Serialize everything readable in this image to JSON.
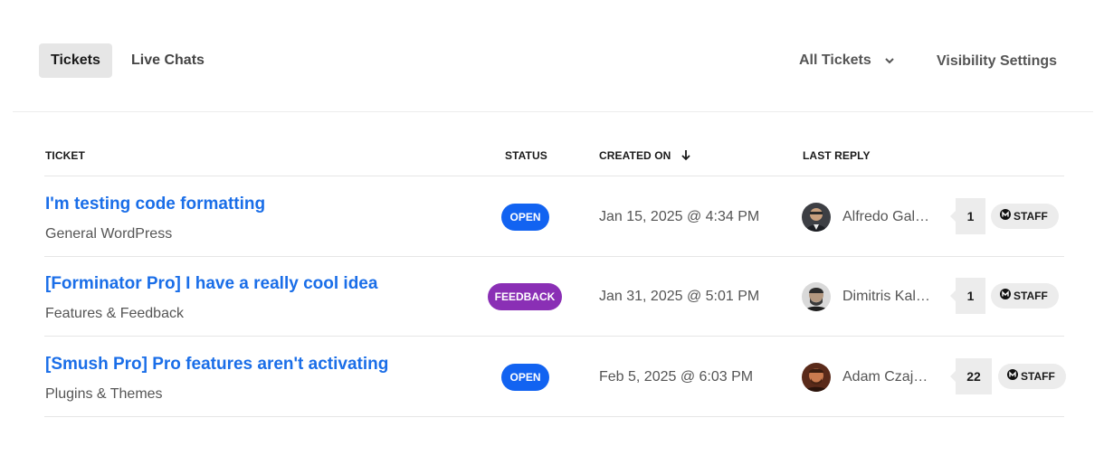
{
  "tabs": [
    {
      "label": "Tickets",
      "active": true
    },
    {
      "label": "Live Chats",
      "active": false
    }
  ],
  "filters": {
    "dropdown_label": "All Tickets",
    "dropdown_icon": "chevron-down-icon",
    "visibility_label": "Visibility Settings"
  },
  "table": {
    "columns": [
      "TICKET",
      "STATUS",
      "CREATED ON",
      "LAST REPLY"
    ],
    "sort_icon": "arrow-down-icon",
    "rows": [
      {
        "title": "I'm testing code formatting",
        "category": "General WordPress",
        "status": "OPEN",
        "created": "Jan 15, 2025 @ 4:34 PM",
        "last_reply": "Alfredo Galano",
        "replies": "1",
        "role": "STAFF"
      },
      {
        "title": "[Forminator Pro] I have a really cool idea",
        "category": "Features & Feedback",
        "status": "FEEDBACK",
        "created": "Jan 31, 2025 @ 5:01 PM",
        "last_reply": "Dimitris Kalliris",
        "replies": "1",
        "role": "STAFF"
      },
      {
        "title": "[Smush Pro] Pro features aren't activating",
        "category": "Plugins & Themes",
        "status": "OPEN",
        "created": "Feb 5, 2025 @ 6:03 PM",
        "last_reply": "Adam Czajczyk",
        "replies": "22",
        "role": "STAFF"
      }
    ]
  },
  "colors": {
    "link": "#1a6ee8",
    "open_badge": "#1263f1",
    "feedback_badge": "#8a2fb5"
  }
}
